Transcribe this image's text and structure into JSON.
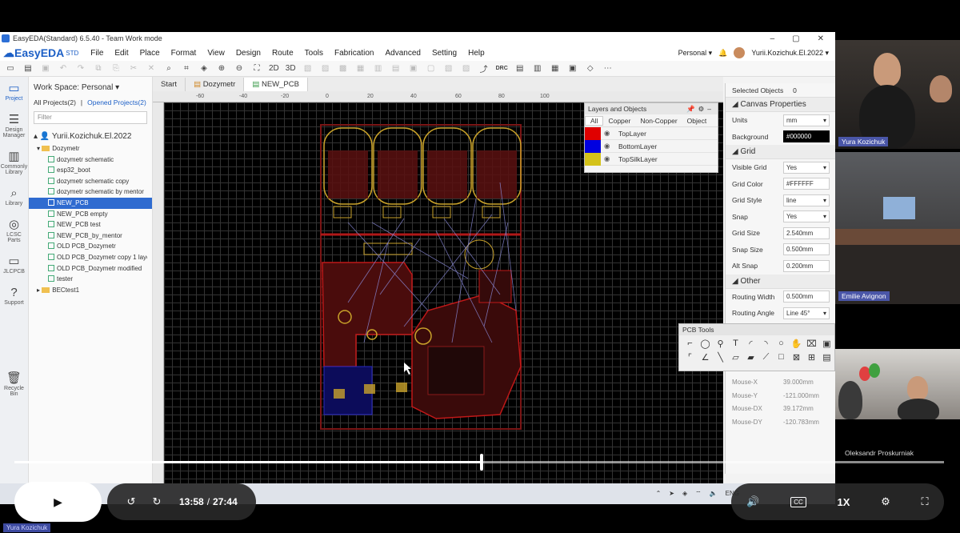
{
  "window": {
    "title": "EasyEDA(Standard) 6.5.40 - Team Work mode",
    "controls": [
      "–",
      "▢",
      "✕"
    ]
  },
  "menubar": {
    "logo": "EasyEDA",
    "logo_suffix": "STD",
    "items": [
      "File",
      "Edit",
      "Place",
      "Format",
      "View",
      "Design",
      "Route",
      "Tools",
      "Fabrication",
      "Advanced",
      "Setting",
      "Help"
    ],
    "workspace": "Personal ▾",
    "user": "Yurii.Kozichuk.El.2022 ▾"
  },
  "toolbar": {
    "view_2d": "2D",
    "view_3d": "3D",
    "drc": "DRC"
  },
  "leftrail": {
    "items": [
      {
        "label": "Project",
        "icon": "folder-icon"
      },
      {
        "label": "Design Manager",
        "icon": "list-icon"
      },
      {
        "label": "Commonly Library",
        "icon": "chip-icon"
      },
      {
        "label": "Library",
        "icon": "search-icon"
      },
      {
        "label": "LCSC Parts",
        "icon": "lcsc-icon"
      },
      {
        "label": "JLCPCB",
        "icon": "jlc-icon"
      },
      {
        "label": "Support",
        "icon": "help-icon"
      },
      {
        "label": "Recycle Bin",
        "icon": "trash-icon"
      }
    ]
  },
  "project_panel": {
    "workspace": "Work Space: Personal ▾",
    "all_projects": "All Projects(2)",
    "separator": "|",
    "opened_projects": "Opened Projects(2)",
    "filter_placeholder": "Filter",
    "user": "Yurii.Kozichuk.El.2022",
    "folder": "Dozymetr",
    "files": [
      "dozymetr schematic",
      "esp32_boot",
      "dozymetr schematic copy",
      "dozymetr schematic by mentor",
      "NEW_PCB",
      "NEW_PCB empty",
      "NEW_PCB test",
      "NEW_PCB_by_mentor",
      "OLD PCB_Dozymetr",
      "OLD PCB_Dozymetr copy 1 layer",
      "OLD PCB_Dozymetr modified",
      "tester"
    ],
    "selected_file": "NEW_PCB",
    "folder2": "BECtest1"
  },
  "tabs": [
    "Start",
    "Dozymetr",
    "NEW_PCB"
  ],
  "ruler": {
    "h_ticks": [
      "-60",
      "-40",
      "-20",
      "0",
      "20",
      "40",
      "60",
      "80",
      "100"
    ]
  },
  "layers_panel": {
    "title": "Layers and Objects",
    "tabs": [
      "All",
      "Copper",
      "Non-Copper",
      "Object"
    ],
    "layers": [
      {
        "name": "TopLayer",
        "color": "#e00000"
      },
      {
        "name": "BottomLayer",
        "color": "#0000e0"
      },
      {
        "name": "TopSilkLayer",
        "color": "#d4c21a"
      }
    ]
  },
  "pcb_tools": {
    "title": "PCB Tools"
  },
  "properties": {
    "selected_objects_label": "Selected Objects",
    "selected_objects_count": "0",
    "canvas_title": "Canvas Properties",
    "units_label": "Units",
    "units": "mm",
    "background_label": "Background",
    "background": "#000000",
    "grid_title": "Grid",
    "visible_grid_label": "Visible Grid",
    "visible_grid": "Yes",
    "grid_color_label": "Grid Color",
    "grid_color": "#FFFFFF",
    "grid_style_label": "Grid Style",
    "grid_style": "line",
    "snap_label": "Snap",
    "snap": "Yes",
    "grid_size_label": "Grid Size",
    "grid_size": "2.540mm",
    "snap_size_label": "Snap Size",
    "snap_size": "0.500mm",
    "alt_snap_label": "Alt Snap",
    "alt_snap": "0.200mm",
    "other_title": "Other",
    "routing_width_label": "Routing Width",
    "routing_width": "0.500mm",
    "routing_angle_label": "Routing Angle",
    "routing_angle": "Line 45°",
    "mouse_x_label": "Mouse-X",
    "mouse_x": "39.000mm",
    "mouse_y_label": "Mouse-Y",
    "mouse_y": "-121.000mm",
    "mouse_dx_label": "Mouse-DX",
    "mouse_dx": "39.172mm",
    "mouse_dy_label": "Mouse-DY",
    "mouse_dy": "-120.783mm"
  },
  "taskbar": {
    "lang": "ENG"
  },
  "video_call": {
    "participant_1": "Yura Kozichuk",
    "participant_2": "Emilie Avignon",
    "participant_3": "Oleksandr Proskurniak"
  },
  "player": {
    "current_time": "13:58",
    "separator": "/",
    "duration": "27:44",
    "progress": 0.503,
    "speed": "1X",
    "cc": "CC",
    "play_icon": "▶"
  },
  "bottom_tag": "Yura Kozichuk"
}
